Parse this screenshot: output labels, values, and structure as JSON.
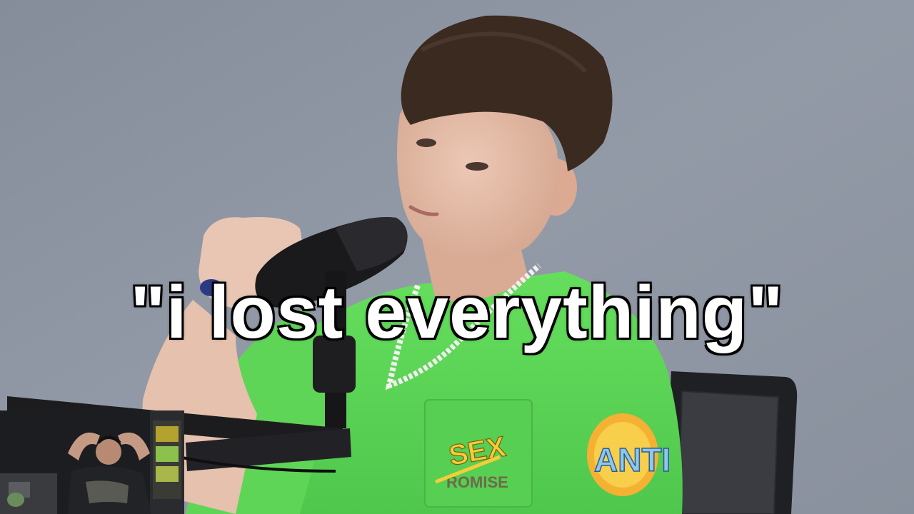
{
  "caption": {
    "text": "\"i lost everything\""
  },
  "shirt_print": {
    "pocket_top": "SEX",
    "pocket_bottom": "ROMISE",
    "sleeve_logo": "ANTI"
  },
  "colors": {
    "wall": "#8d95a3",
    "shirt": "#5ed85a",
    "hair": "#3a2a20",
    "skin": "#e3b9a4",
    "caption_fill": "#ffffff",
    "caption_stroke": "#000000"
  }
}
